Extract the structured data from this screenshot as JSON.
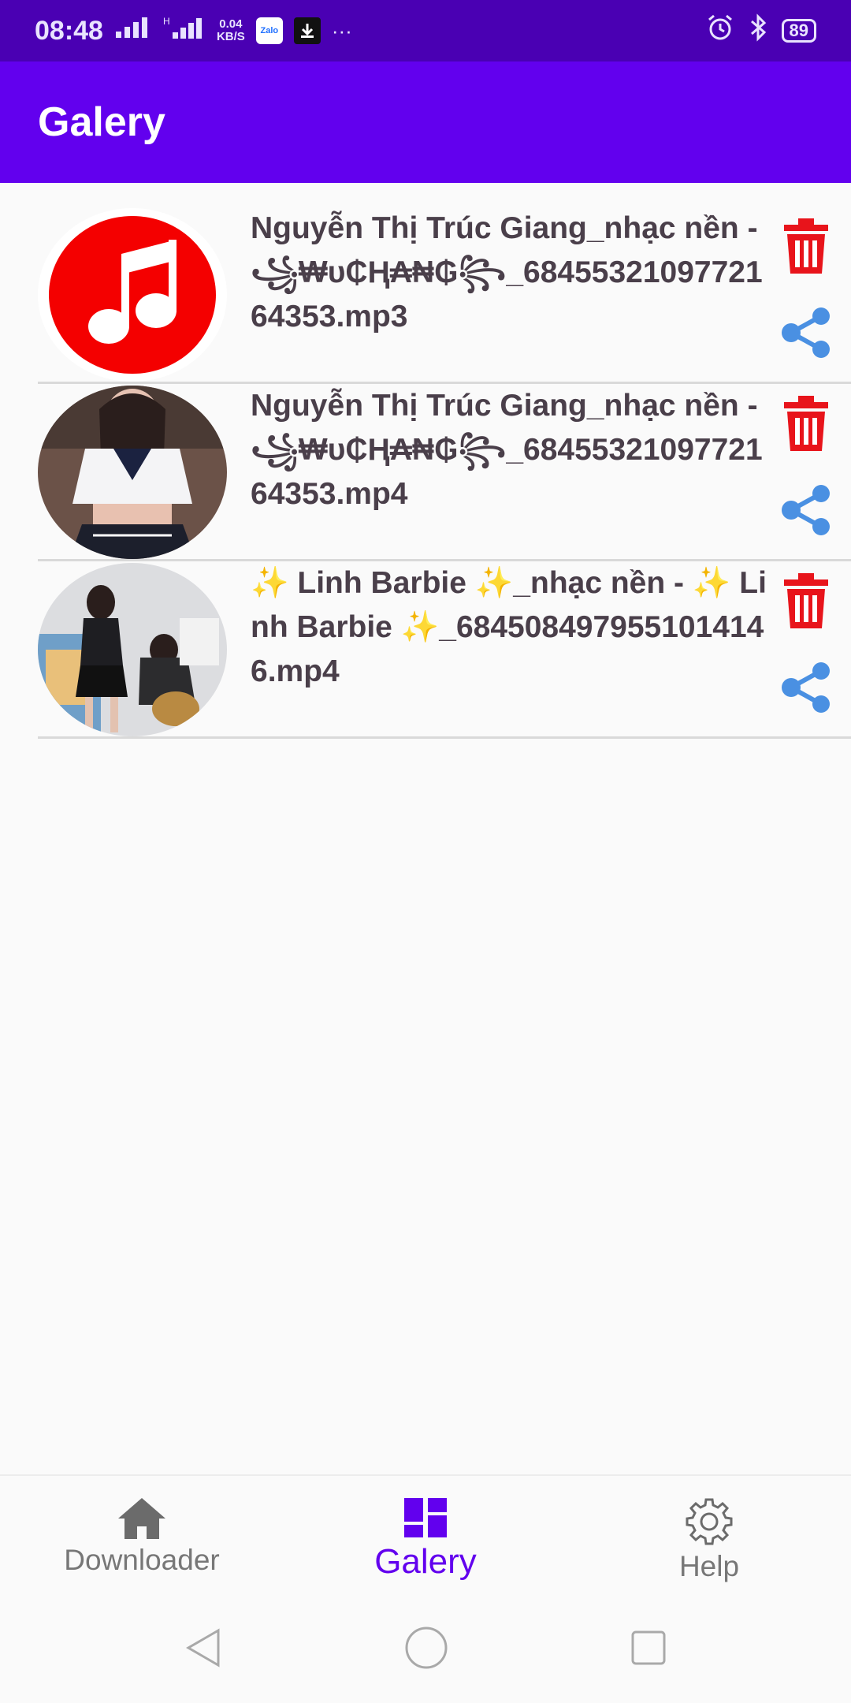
{
  "status_bar": {
    "time": "08:48",
    "net_speed_value": "0.04",
    "net_speed_unit": "KB/S",
    "app_icon_label": "Zalo",
    "more": "···",
    "battery": "89"
  },
  "app_bar": {
    "title": "Galery"
  },
  "items": [
    {
      "title": "Nguyễn Thị Trúc Giang_nhạc nền - ꧁₩ᴜ₵Ⱨ₳₦₲꧂_6845532109772164353.mp3",
      "thumbnail": "music-note-icon"
    },
    {
      "title": "Nguyễn Thị Trúc Giang_nhạc nền - ꧁₩ᴜ₵Ⱨ₳₦₲꧂_6845532109772164353.mp4",
      "thumbnail": "video-thumbnail"
    },
    {
      "title": "✨ Linh Barbie ✨_nhạc nền - ✨ Linh Barbie ✨_6845084979551014146.mp4",
      "thumbnail": "video-thumbnail"
    }
  ],
  "bottom_nav": {
    "items": [
      {
        "label": "Downloader",
        "icon": "home-icon",
        "active": false
      },
      {
        "label": "Galery",
        "icon": "dashboard-icon",
        "active": true
      },
      {
        "label": "Help",
        "icon": "gear-icon",
        "active": false
      }
    ]
  },
  "colors": {
    "status_bar": "#4a00b3",
    "app_bar": "#6200ee",
    "delete": "#e8141b",
    "share": "#4a90e2",
    "active_nav": "#6200ee"
  }
}
